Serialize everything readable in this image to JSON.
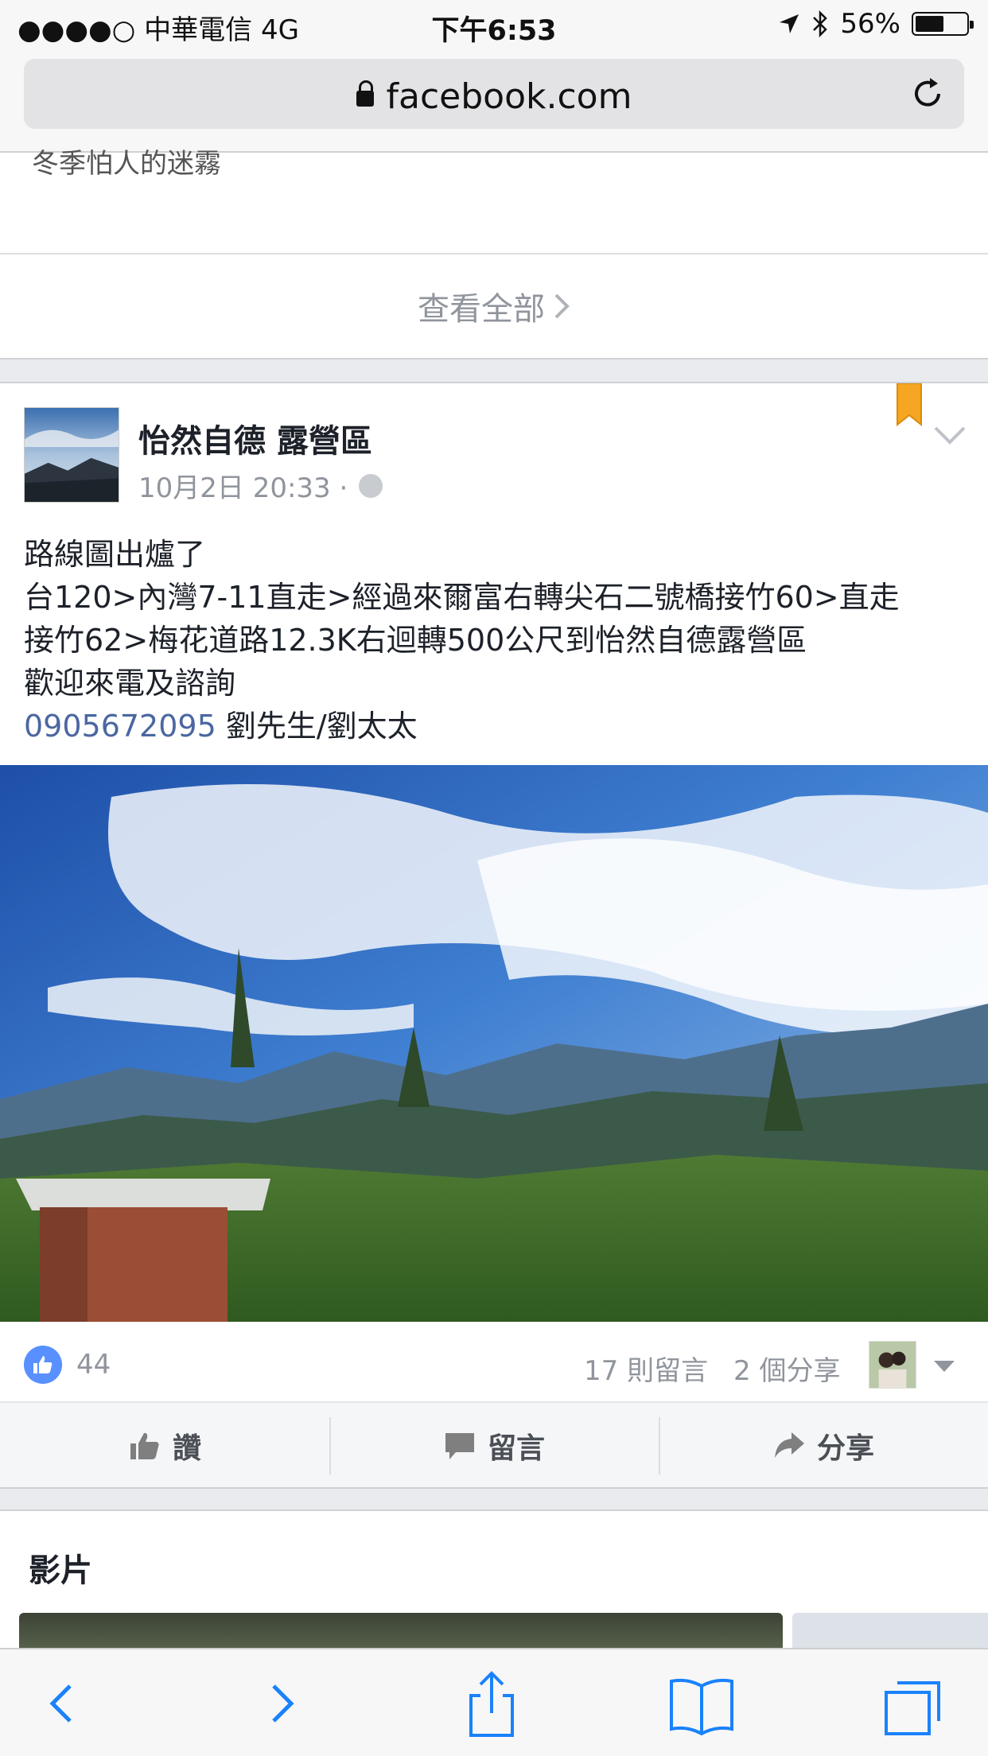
{
  "status_bar": {
    "carrier": "●●●●○ 中華電信   4G",
    "time": "下午6:53",
    "battery_percent": "56%",
    "battery_level": 0.56
  },
  "browser": {
    "url": "facebook.com"
  },
  "previous_section": {
    "clipped_text": "冬季怕人的迷霧",
    "see_all_label": "查看全部"
  },
  "post": {
    "page_name": "怡然自德 露營區",
    "timestamp": "10月2日 20:33 ·",
    "lines": [
      "路線圖出爐了",
      "台120>內灣7-11直走>經過來爾富右轉尖石二號橋接竹60>直走",
      "接竹62>梅花道路12.3K右迴轉500公尺到怡然自德露營區",
      "歡迎來電及諮詢"
    ],
    "phone": "0905672095",
    "contact": " 劉先生/劉太太",
    "likes": "44",
    "comments": "17 則留言",
    "shares": "2 個分享",
    "actions": {
      "like": "讚",
      "comment": "留言",
      "share": "分享"
    }
  },
  "videos_section": {
    "title": "影片"
  },
  "colors": {
    "facebook_blue": "#5890ff",
    "link_blue": "#4b67a1",
    "bookmark_orange": "#f5a623",
    "ios_blue": "#1a82fb"
  },
  "icons": [
    "lock-icon",
    "reload-icon",
    "bookmark-icon",
    "chevron-down-icon",
    "globe-icon",
    "like-icon",
    "comment-icon",
    "share-icon",
    "back-icon",
    "forward-icon",
    "share-sheet-icon",
    "bookmarks-icon",
    "tabs-icon"
  ]
}
